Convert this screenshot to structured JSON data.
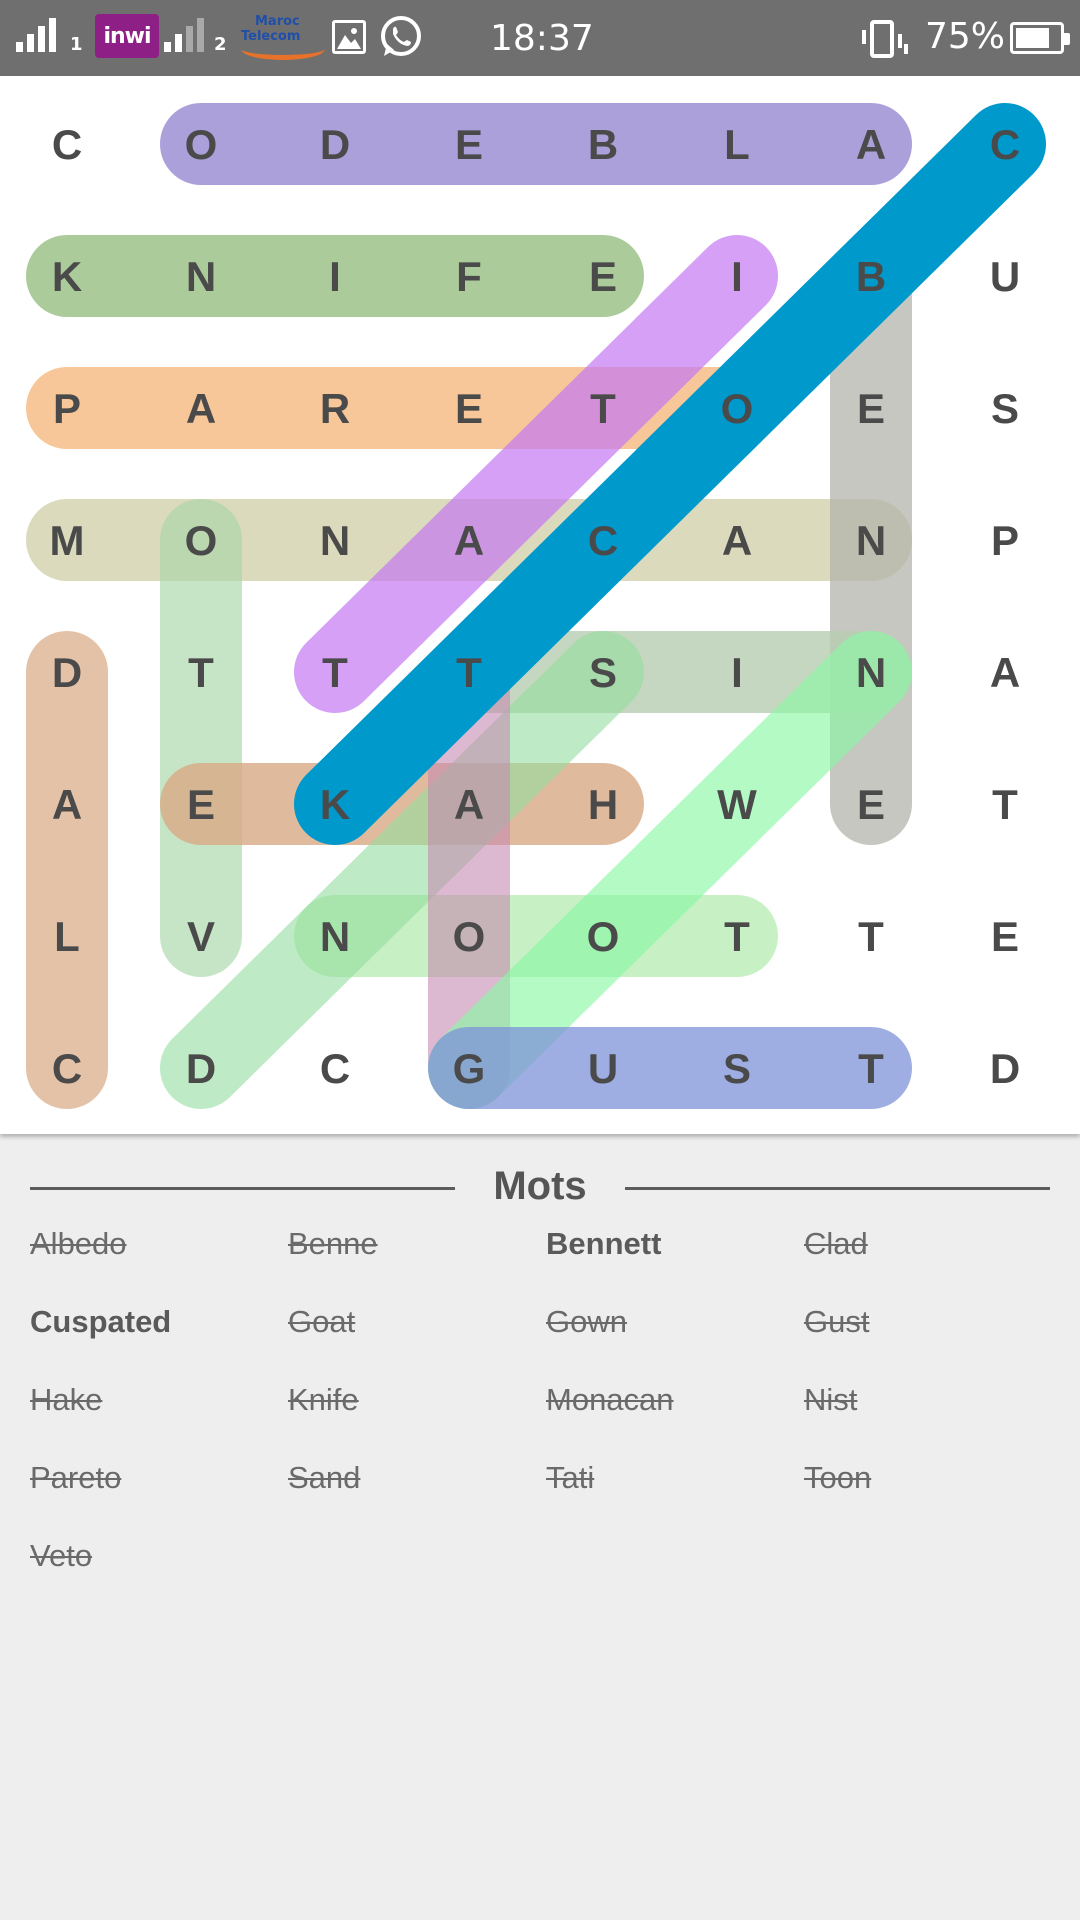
{
  "status_bar": {
    "sim1_label": "1",
    "sim2_label": "2",
    "operator1": "inwi",
    "operator2_line1": "Maroc",
    "operator2_line2": "Telecom",
    "time": "18:37",
    "battery_percent": "75%",
    "battery_level": 0.75,
    "icons": [
      "signal-icon",
      "signal-icon",
      "gallery-icon",
      "whatsapp-icon",
      "vibrate-icon",
      "battery-icon"
    ]
  },
  "grid": {
    "rows": [
      [
        "C",
        "O",
        "D",
        "E",
        "B",
        "L",
        "A",
        "C"
      ],
      [
        "K",
        "N",
        "I",
        "F",
        "E",
        "I",
        "B",
        "U"
      ],
      [
        "P",
        "A",
        "R",
        "E",
        "T",
        "O",
        "E",
        "S"
      ],
      [
        "M",
        "O",
        "N",
        "A",
        "C",
        "A",
        "N",
        "P"
      ],
      [
        "D",
        "T",
        "T",
        "T",
        "S",
        "I",
        "N",
        "A"
      ],
      [
        "A",
        "E",
        "K",
        "A",
        "H",
        "W",
        "E",
        "T"
      ],
      [
        "L",
        "V",
        "N",
        "O",
        "O",
        "T",
        "T",
        "E"
      ],
      [
        "C",
        "D",
        "C",
        "G",
        "U",
        "S",
        "T",
        "D"
      ]
    ],
    "highlights": [
      {
        "word": "Albedo",
        "from": [
          0,
          6
        ],
        "to": [
          0,
          1
        ],
        "color": "#9c8fd3",
        "opacity": 0.85
      },
      {
        "word": "Knife",
        "from": [
          1,
          0
        ],
        "to": [
          1,
          4
        ],
        "color": "#9cc28a",
        "opacity": 0.85
      },
      {
        "word": "Pareto",
        "from": [
          2,
          0
        ],
        "to": [
          2,
          5
        ],
        "color": "#f5b880",
        "opacity": 0.8
      },
      {
        "word": "Monacan",
        "from": [
          3,
          0
        ],
        "to": [
          3,
          6
        ],
        "color": "#d6d4b0",
        "opacity": 0.85
      },
      {
        "word": "Benne",
        "from": [
          1,
          6
        ],
        "to": [
          5,
          6
        ],
        "color": "#b4b4ac",
        "opacity": 0.75
      },
      {
        "word": "Veto",
        "from": [
          6,
          1
        ],
        "to": [
          3,
          1
        ],
        "color": "#a7d6a7",
        "opacity": 0.65
      },
      {
        "word": "Clad",
        "from": [
          7,
          0
        ],
        "to": [
          4,
          0
        ],
        "color": "#d9a882",
        "opacity": 0.7
      },
      {
        "word": "Hake",
        "from": [
          5,
          4
        ],
        "to": [
          5,
          1
        ],
        "color": "#d8a985",
        "opacity": 0.8
      },
      {
        "word": "Nist",
        "from": [
          4,
          6
        ],
        "to": [
          4,
          3
        ],
        "color": "#b7cdb0",
        "opacity": 0.8
      },
      {
        "word": "Toon",
        "from": [
          6,
          5
        ],
        "to": [
          6,
          2
        ],
        "color": "#a9e9a4",
        "opacity": 0.65
      },
      {
        "word": "Tati",
        "from": [
          4,
          2
        ],
        "to": [
          1,
          5
        ],
        "color": "#c378f2",
        "opacity": 0.7
      },
      {
        "word": "Sand",
        "from": [
          4,
          4
        ],
        "to": [
          7,
          1
        ],
        "color": "#93dd9f",
        "opacity": 0.6
      },
      {
        "word": "Tati2",
        "from": [
          4,
          3
        ],
        "to": [
          7,
          3
        ],
        "color": "#c58bb0",
        "opacity": 0.6
      },
      {
        "word": "Goat",
        "from": [
          7,
          3
        ],
        "to": [
          4,
          6
        ],
        "color": "#8af7a5",
        "opacity": 0.65
      },
      {
        "word": "Gust",
        "from": [
          7,
          3
        ],
        "to": [
          7,
          6
        ],
        "color": "#7d93da",
        "opacity": 0.75
      },
      {
        "word": "Gown",
        "from": [
          5,
          2
        ],
        "to": [
          0,
          7
        ],
        "color": "#0099cc",
        "opacity": 1.0
      }
    ]
  },
  "words_panel": {
    "title": "Mots",
    "words": [
      {
        "label": "Albedo",
        "found": true
      },
      {
        "label": "Benne",
        "found": true
      },
      {
        "label": "Bennett",
        "found": false
      },
      {
        "label": "Clad",
        "found": true
      },
      {
        "label": "Cuspated",
        "found": false
      },
      {
        "label": "Goat",
        "found": true
      },
      {
        "label": "Gown",
        "found": true
      },
      {
        "label": "Gust",
        "found": true
      },
      {
        "label": "Hake",
        "found": true
      },
      {
        "label": "Knife",
        "found": true
      },
      {
        "label": "Monacan",
        "found": true
      },
      {
        "label": "Nist",
        "found": true
      },
      {
        "label": "Pareto",
        "found": true
      },
      {
        "label": "Sand",
        "found": true
      },
      {
        "label": "Tati",
        "found": true
      },
      {
        "label": "Toon",
        "found": true
      },
      {
        "label": "Veto",
        "found": true
      }
    ]
  },
  "colors": {
    "status_bar": "#6f6f6f",
    "grid_background": "#ffffff",
    "letter": "#4a4a4a",
    "panel_background": "#eeeeee"
  }
}
